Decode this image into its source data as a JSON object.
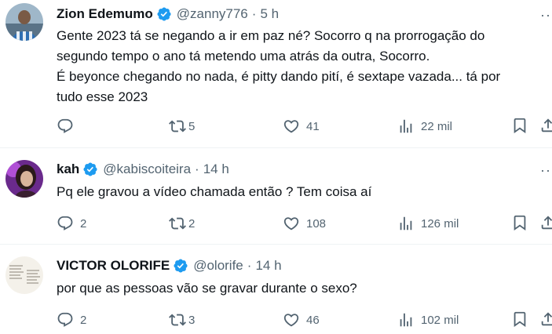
{
  "tweets": [
    {
      "name": "Zion Edemumo",
      "handle": "@zanny776",
      "time": "5 h",
      "lines": [
        "Gente 2023 tá se negando a ir em paz né? Socorro q na prorrogação do",
        "segundo tempo o ano tá metendo uma atrás da outra, Socorro.",
        "É beyonce chegando no nada, é pitty dando pití, é sextape vazada... tá por",
        "tudo esse 2023"
      ],
      "replies": "",
      "retweets": "5",
      "likes": "41",
      "views": "22 mil"
    },
    {
      "name": "kah",
      "handle": "@kabiscoiteira",
      "time": "14 h",
      "lines": [
        "Pq ele gravou a vídeo chamada então ? Tem coisa aí"
      ],
      "replies": "2",
      "retweets": "2",
      "likes": "108",
      "views": "126 mil"
    },
    {
      "name": "VICTOR OLORIFE",
      "handle": "@olorife",
      "time": "14 h",
      "lines": [
        "por que as pessoas vão se gravar durante o sexo?"
      ],
      "replies": "2",
      "retweets": "3",
      "likes": "46",
      "views": "102 mil"
    }
  ],
  "dot": "·",
  "more": "···",
  "colors": {
    "verified": "#1d9bf0",
    "muted": "#536471",
    "text": "#0f1419"
  },
  "icons": [
    "verified-badge-icon",
    "reply-icon",
    "retweet-icon",
    "like-icon",
    "views-icon",
    "bookmark-icon",
    "share-icon",
    "more-icon"
  ]
}
